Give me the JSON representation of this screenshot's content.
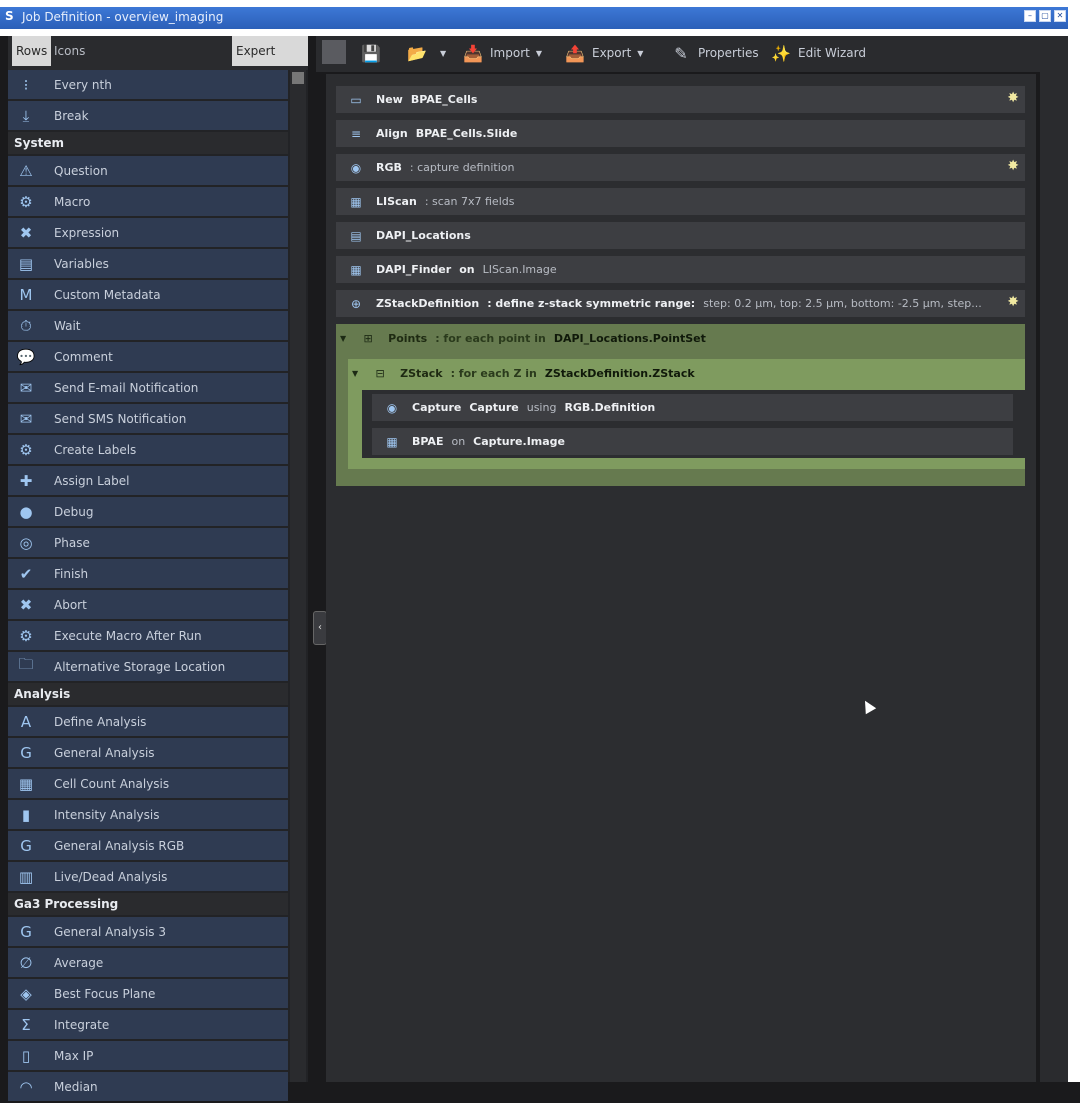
{
  "window": {
    "title": "Job Definition - overview_imaging",
    "buttons": [
      "minimize",
      "maximize",
      "close"
    ]
  },
  "sidebar": {
    "view_tabs": [
      "Rows",
      "Icons"
    ],
    "expert_label": "Expert mode",
    "groups": [
      {
        "header": "",
        "items": [
          {
            "icon": "every-nth-icon",
            "label": "Every nth"
          },
          {
            "icon": "break-icon",
            "label": "Break"
          }
        ]
      },
      {
        "header": "System",
        "items": [
          {
            "icon": "question-icon",
            "label": "Question"
          },
          {
            "icon": "macro-icon",
            "label": "Macro"
          },
          {
            "icon": "expression-icon",
            "label": "Expression"
          },
          {
            "icon": "variables-icon",
            "label": "Variables"
          },
          {
            "icon": "metadata-icon",
            "label": "Custom Metadata"
          },
          {
            "icon": "wait-icon",
            "label": "Wait"
          },
          {
            "icon": "comment-icon",
            "label": "Comment"
          },
          {
            "icon": "email-icon",
            "label": "Send E-mail Notification"
          },
          {
            "icon": "sms-icon",
            "label": "Send SMS Notification"
          },
          {
            "icon": "create-labels-icon",
            "label": "Create Labels"
          },
          {
            "icon": "assign-label-icon",
            "label": "Assign Label"
          },
          {
            "icon": "debug-icon",
            "label": "Debug"
          },
          {
            "icon": "phase-icon",
            "label": "Phase"
          },
          {
            "icon": "finish-icon",
            "label": "Finish"
          },
          {
            "icon": "abort-icon",
            "label": "Abort"
          },
          {
            "icon": "execute-macro-icon",
            "label": "Execute Macro After Run"
          },
          {
            "icon": "storage-icon",
            "label": "Alternative Storage Location"
          }
        ]
      },
      {
        "header": "Analysis",
        "items": [
          {
            "icon": "define-analysis-icon",
            "label": "Define Analysis"
          },
          {
            "icon": "general-analysis-icon",
            "label": "General Analysis"
          },
          {
            "icon": "cell-count-icon",
            "label": "Cell Count Analysis"
          },
          {
            "icon": "intensity-icon",
            "label": "Intensity Analysis"
          },
          {
            "icon": "general-analysis-rgb-icon",
            "label": "General Analysis RGB"
          },
          {
            "icon": "live-dead-icon",
            "label": "Live/Dead Analysis"
          }
        ]
      },
      {
        "header": "Ga3 Processing",
        "items": [
          {
            "icon": "general-analysis-3-icon",
            "label": "General Analysis 3"
          },
          {
            "icon": "average-icon",
            "label": "Average"
          },
          {
            "icon": "best-focus-icon",
            "label": "Best Focus Plane"
          },
          {
            "icon": "integrate-icon",
            "label": "Integrate"
          },
          {
            "icon": "max-ip-icon",
            "label": "Max IP"
          },
          {
            "icon": "median-icon",
            "label": "Median"
          }
        ]
      }
    ]
  },
  "toolbar": {
    "import_label": "Import",
    "export_label": "Export",
    "properties_label": "Properties",
    "wizard_label": "Edit Wizard"
  },
  "steps": [
    {
      "kw": "New",
      "name": "BPAE_Cells",
      "rest": "",
      "star": true
    },
    {
      "kw": "Align",
      "name": "BPAE_Cells.Slide",
      "rest": "",
      "star": false
    },
    {
      "kw": "RGB",
      "name": "",
      "rest": ": capture definition",
      "star": true
    },
    {
      "kw": "LIScan",
      "name": "",
      "rest": ": scan 7x7 fields",
      "star": false
    },
    {
      "kw": "DAPI_Locations",
      "name": "",
      "rest": "",
      "star": false
    },
    {
      "kw": "DAPI_Finder",
      "name": "on",
      "rest": "LIScan.Image",
      "star": false
    },
    {
      "kw": "ZStackDefinition",
      "name": ": define z-stack symmetric range:",
      "rest": "step: 0.2 µm, top: 2.5 µm, bottom: -2.5 µm, step...",
      "star": true
    }
  ],
  "loop_points": {
    "kw": "Points",
    "rest": ": for each point in",
    "target": "DAPI_Locations.PointSet"
  },
  "loop_zstack": {
    "kw": "ZStack",
    "rest": ": for each Z in",
    "target": "ZStackDefinition.ZStack"
  },
  "inner_steps": [
    {
      "kw": "Capture",
      "name": "Capture",
      "mid": "using",
      "target": "RGB.Definition"
    },
    {
      "kw": "BPAE",
      "name": "on",
      "mid": "",
      "target": "Capture.Image"
    }
  ]
}
